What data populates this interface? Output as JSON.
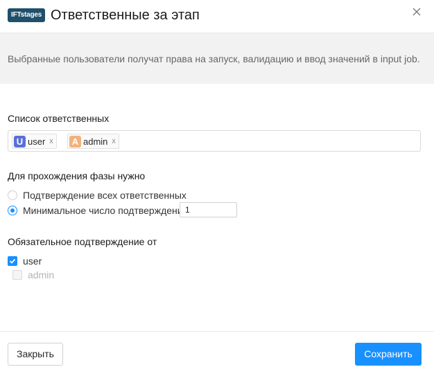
{
  "header": {
    "badge": "IFTstages",
    "title": "Ответственные за этап"
  },
  "info": {
    "text": "Выбранные пользователи получат права на запуск, валидацию и ввод значений в input job."
  },
  "responsible": {
    "label": "Список ответственных",
    "tags": [
      {
        "avatar": "U",
        "name": "user",
        "color": "#5b6fd8"
      },
      {
        "avatar": "A",
        "name": "admin",
        "color": "#f3b27a"
      }
    ],
    "remove_glyph": "x"
  },
  "phase": {
    "label": "Для прохождения фазы нужно",
    "options": [
      {
        "label": "Подтверждение всех ответственных",
        "checked": false
      },
      {
        "label": "Минимальное число подтверждений",
        "checked": true
      }
    ],
    "min_value": "1"
  },
  "mandatory": {
    "label": "Обязательное подтверждение от",
    "items": [
      {
        "label": "user",
        "checked": true,
        "disabled": false
      },
      {
        "label": "admin",
        "checked": false,
        "disabled": true
      }
    ]
  },
  "footer": {
    "close_label": "Закрыть",
    "save_label": "Сохранить"
  },
  "colors": {
    "accent": "#1890ff",
    "badge_bg": "#1f4f6b"
  }
}
